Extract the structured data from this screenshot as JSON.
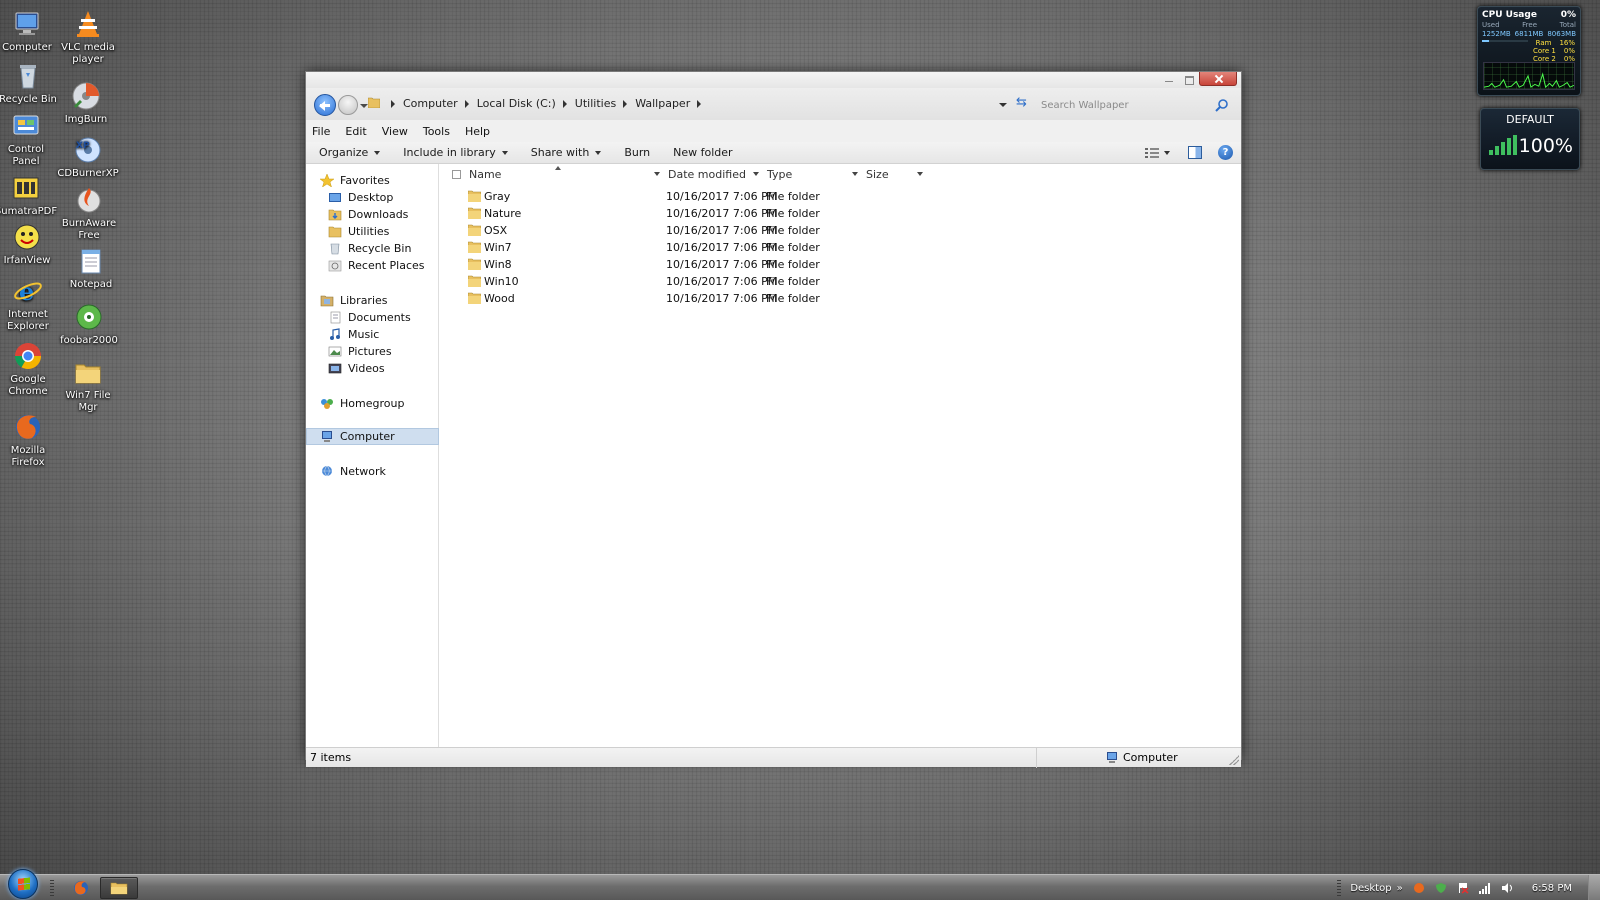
{
  "desktop": {
    "icons": [
      {
        "label": "Computer",
        "icon": "computer-icon"
      },
      {
        "label": "VLC media player",
        "icon": "vlc-icon"
      },
      {
        "label": "Recycle Bin",
        "icon": "recycle-bin-icon"
      },
      {
        "label": "ImgBurn",
        "icon": "imgburn-icon"
      },
      {
        "label": "Control Panel",
        "icon": "control-panel-icon"
      },
      {
        "label": "CDBurnerXP",
        "icon": "cdburnerxp-icon"
      },
      {
        "label": "SumatraPDF",
        "icon": "sumatrapdf-icon"
      },
      {
        "label": "BurnAware Free",
        "icon": "burnaware-icon"
      },
      {
        "label": "IrfanView",
        "icon": "irfanview-icon"
      },
      {
        "label": "Notepad",
        "icon": "notepad-icon"
      },
      {
        "label": "Internet Explorer",
        "icon": "internet-explorer-icon"
      },
      {
        "label": "foobar2000",
        "icon": "foobar2000-icon"
      },
      {
        "label": "Google Chrome",
        "icon": "chrome-icon"
      },
      {
        "label": "Win7 File Mgr",
        "icon": "file-manager-icon"
      },
      {
        "label": "Mozilla Firefox",
        "icon": "firefox-icon"
      }
    ]
  },
  "gadgets": {
    "cpu": {
      "title": "CPU Usage",
      "percent": "0%",
      "headers": [
        "Used",
        "Free",
        "Total"
      ],
      "values": [
        "1252MB",
        "6811MB",
        "8063MB"
      ],
      "rows": [
        {
          "label": "Ram",
          "value": "16%"
        },
        {
          "label": "Core 1",
          "value": "0%"
        },
        {
          "label": "Core 2",
          "value": "0%"
        }
      ],
      "ram_fraction": 0.16
    },
    "network": {
      "label": "DEFAULT",
      "percent": "100%"
    }
  },
  "explorer": {
    "breadcrumb": [
      "Computer",
      "Local Disk (C:)",
      "Utilities",
      "Wallpaper"
    ],
    "search_placeholder": "Search Wallpaper",
    "menu": [
      "File",
      "Edit",
      "View",
      "Tools",
      "Help"
    ],
    "toolbar": {
      "organize": "Organize",
      "include": "Include in library",
      "share": "Share with",
      "burn": "Burn",
      "new_folder": "New folder"
    },
    "nav": {
      "favorites": "Favorites",
      "favorites_items": [
        "Desktop",
        "Downloads",
        "Utilities",
        "Recycle Bin",
        "Recent Places"
      ],
      "libraries": "Libraries",
      "libraries_items": [
        "Documents",
        "Music",
        "Pictures",
        "Videos"
      ],
      "homegroup": "Homegroup",
      "computer": "Computer",
      "network": "Network"
    },
    "columns": {
      "name": "Name",
      "date": "Date modified",
      "type": "Type",
      "size": "Size"
    },
    "files": [
      {
        "name": "Gray",
        "date": "10/16/2017 7:06 PM",
        "type": "File folder"
      },
      {
        "name": "Nature",
        "date": "10/16/2017 7:06 PM",
        "type": "File folder"
      },
      {
        "name": "OSX",
        "date": "10/16/2017 7:06 PM",
        "type": "File folder"
      },
      {
        "name": "Win7",
        "date": "10/16/2017 7:06 PM",
        "type": "File folder"
      },
      {
        "name": "Win8",
        "date": "10/16/2017 7:06 PM",
        "type": "File folder"
      },
      {
        "name": "Win10",
        "date": "10/16/2017 7:06 PM",
        "type": "File folder"
      },
      {
        "name": "Wood",
        "date": "10/16/2017 7:06 PM",
        "type": "File folder"
      }
    ],
    "status": {
      "count": "7 items",
      "location": "Computer"
    }
  },
  "taskbar": {
    "desktop_label": "Desktop",
    "clock": "6:58 PM"
  },
  "colors": {
    "selection": "#cfdeef",
    "folder": "#e8c060",
    "accent_blue": "#2b6fd4"
  }
}
